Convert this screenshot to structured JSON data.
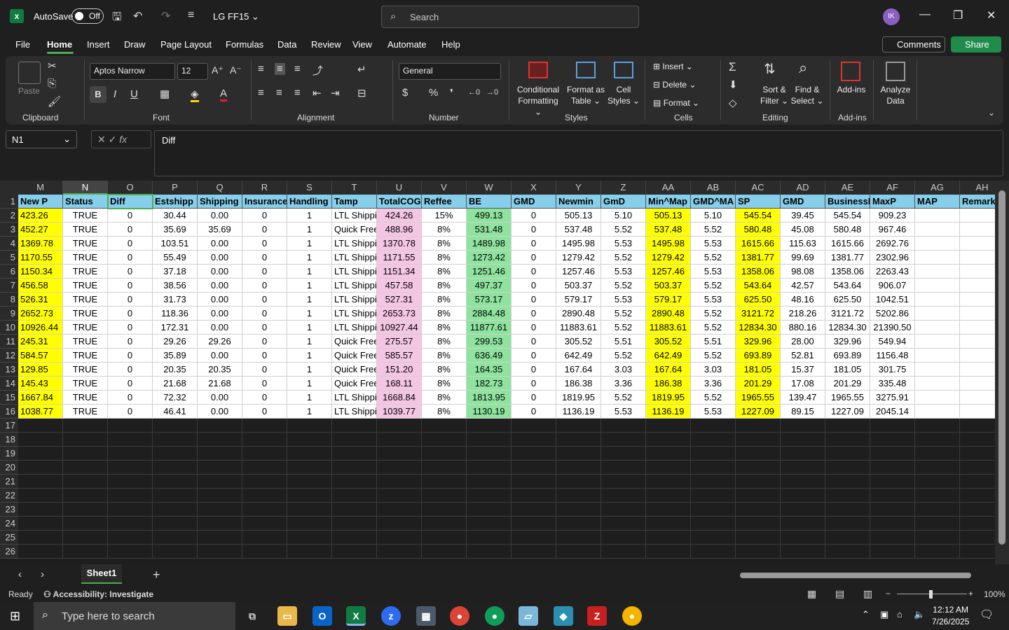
{
  "app": {
    "autosave_label": "AutoSave",
    "autosave_state": "Off",
    "filename": "LG FF15",
    "search_placeholder": "Search",
    "avatar": "IK"
  },
  "menu": [
    "File",
    "Home",
    "Insert",
    "Draw",
    "Page Layout",
    "Formulas",
    "Data",
    "Review",
    "View",
    "Automate",
    "Help"
  ],
  "buttons": {
    "comments": "Comments",
    "share": "Share"
  },
  "ribbon": {
    "clipboard": {
      "paste": "Paste",
      "label": "Clipboard"
    },
    "font": {
      "name": "Aptos Narrow",
      "size": "12",
      "label": "Font"
    },
    "alignment": {
      "label": "Alignment"
    },
    "number": {
      "format": "General",
      "label": "Number"
    },
    "styles": {
      "cond1": "Conditional",
      "cond2": "Formatting",
      "fmt1": "Format as",
      "fmt2": "Table",
      "cell1": "Cell",
      "cell2": "Styles",
      "label": "Styles"
    },
    "cells": {
      "insert": "Insert",
      "delete": "Delete",
      "format": "Format",
      "label": "Cells"
    },
    "editing": {
      "sort1": "Sort &",
      "sort2": "Filter",
      "find1": "Find &",
      "find2": "Select",
      "label": "Editing"
    },
    "addins": {
      "addins": "Add-ins",
      "label": "Add-ins"
    },
    "analyze": {
      "a1": "Analyze",
      "a2": "Data"
    }
  },
  "formula": {
    "namebox": "N1",
    "content": "Diff"
  },
  "columns": [
    "M",
    "N",
    "O",
    "P",
    "Q",
    "R",
    "S",
    "T",
    "U",
    "V",
    "W",
    "X",
    "Y",
    "Z",
    "AA",
    "AB",
    "AC",
    "AD",
    "AE",
    "AF",
    "AG",
    "AH"
  ],
  "header_row": [
    "New P",
    "Status",
    "Diff",
    "Estshipp",
    "Shipping",
    "Insurance",
    "Handling",
    "Tamp",
    "TotalCOG",
    "Reffee",
    "BE",
    "GMD",
    "Newmin",
    "GmD",
    "Min^Map",
    "GMD^MA",
    "SP",
    "GMD",
    "BusinessI",
    "MaxP",
    "MAP",
    "Remark"
  ],
  "rows": [
    [
      "423.26",
      "TRUE",
      "0",
      "30.44",
      "0.00",
      "0",
      "1",
      "LTL Shippi",
      "424.26",
      "15%",
      "499.13",
      "0",
      "505.13",
      "5.10",
      "505.13",
      "5.10",
      "545.54",
      "39.45",
      "545.54",
      "909.23",
      "",
      ""
    ],
    [
      "452.27",
      "TRUE",
      "0",
      "35.69",
      "35.69",
      "0",
      "1",
      "Quick Free",
      "488.96",
      "8%",
      "531.48",
      "0",
      "537.48",
      "5.52",
      "537.48",
      "5.52",
      "580.48",
      "45.08",
      "580.48",
      "967.46",
      "",
      ""
    ],
    [
      "1369.78",
      "TRUE",
      "0",
      "103.51",
      "0.00",
      "0",
      "1",
      "LTL Shippi",
      "1370.78",
      "8%",
      "1489.98",
      "0",
      "1495.98",
      "5.53",
      "1495.98",
      "5.53",
      "1615.66",
      "115.63",
      "1615.66",
      "2692.76",
      "",
      ""
    ],
    [
      "1170.55",
      "TRUE",
      "0",
      "55.49",
      "0.00",
      "0",
      "1",
      "LTL Shippi",
      "1171.55",
      "8%",
      "1273.42",
      "0",
      "1279.42",
      "5.52",
      "1279.42",
      "5.52",
      "1381.77",
      "99.69",
      "1381.77",
      "2302.96",
      "",
      ""
    ],
    [
      "1150.34",
      "TRUE",
      "0",
      "37.18",
      "0.00",
      "0",
      "1",
      "LTL Shippi",
      "1151.34",
      "8%",
      "1251.46",
      "0",
      "1257.46",
      "5.53",
      "1257.46",
      "5.53",
      "1358.06",
      "98.08",
      "1358.06",
      "2263.43",
      "",
      ""
    ],
    [
      "456.58",
      "TRUE",
      "0",
      "38.56",
      "0.00",
      "0",
      "1",
      "LTL Shippi",
      "457.58",
      "8%",
      "497.37",
      "0",
      "503.37",
      "5.52",
      "503.37",
      "5.52",
      "543.64",
      "42.57",
      "543.64",
      "906.07",
      "",
      ""
    ],
    [
      "526.31",
      "TRUE",
      "0",
      "31.73",
      "0.00",
      "0",
      "1",
      "LTL Shippi",
      "527.31",
      "8%",
      "573.17",
      "0",
      "579.17",
      "5.53",
      "579.17",
      "5.53",
      "625.50",
      "48.16",
      "625.50",
      "1042.51",
      "",
      ""
    ],
    [
      "2652.73",
      "TRUE",
      "0",
      "118.36",
      "0.00",
      "0",
      "1",
      "LTL Shippi",
      "2653.73",
      "8%",
      "2884.48",
      "0",
      "2890.48",
      "5.52",
      "2890.48",
      "5.52",
      "3121.72",
      "218.26",
      "3121.72",
      "5202.86",
      "",
      ""
    ],
    [
      "10926.44",
      "TRUE",
      "0",
      "172.31",
      "0.00",
      "0",
      "1",
      "LTL Shippi",
      "10927.44",
      "8%",
      "11877.61",
      "0",
      "11883.61",
      "5.52",
      "11883.61",
      "5.52",
      "12834.30",
      "880.16",
      "12834.30",
      "21390.50",
      "",
      ""
    ],
    [
      "245.31",
      "TRUE",
      "0",
      "29.26",
      "29.26",
      "0",
      "1",
      "Quick Free",
      "275.57",
      "8%",
      "299.53",
      "0",
      "305.52",
      "5.51",
      "305.52",
      "5.51",
      "329.96",
      "28.00",
      "329.96",
      "549.94",
      "",
      ""
    ],
    [
      "584.57",
      "TRUE",
      "0",
      "35.89",
      "0.00",
      "0",
      "1",
      "Quick Free",
      "585.57",
      "8%",
      "636.49",
      "0",
      "642.49",
      "5.52",
      "642.49",
      "5.52",
      "693.89",
      "52.81",
      "693.89",
      "1156.48",
      "",
      ""
    ],
    [
      "129.85",
      "TRUE",
      "0",
      "20.35",
      "20.35",
      "0",
      "1",
      "Quick Free",
      "151.20",
      "8%",
      "164.35",
      "0",
      "167.64",
      "3.03",
      "167.64",
      "3.03",
      "181.05",
      "15.37",
      "181.05",
      "301.75",
      "",
      ""
    ],
    [
      "145.43",
      "TRUE",
      "0",
      "21.68",
      "21.68",
      "0",
      "1",
      "Quick Free",
      "168.11",
      "8%",
      "182.73",
      "0",
      "186.38",
      "3.36",
      "186.38",
      "3.36",
      "201.29",
      "17.08",
      "201.29",
      "335.48",
      "",
      ""
    ],
    [
      "1667.84",
      "TRUE",
      "0",
      "72.32",
      "0.00",
      "0",
      "1",
      "LTL Shippi",
      "1668.84",
      "8%",
      "1813.95",
      "0",
      "1819.95",
      "5.52",
      "1819.95",
      "5.52",
      "1965.55",
      "139.47",
      "1965.55",
      "3275.91",
      "",
      ""
    ],
    [
      "1038.77",
      "TRUE",
      "0",
      "46.41",
      "0.00",
      "0",
      "1",
      "LTL Shippi",
      "1039.77",
      "8%",
      "1130.19",
      "0",
      "1136.19",
      "5.53",
      "1136.19",
      "5.53",
      "1227.09",
      "89.15",
      "1227.09",
      "2045.14",
      "",
      ""
    ]
  ],
  "row_numbers": [
    "1",
    "2",
    "3",
    "4",
    "5",
    "6",
    "7",
    "8",
    "9",
    "10",
    "11",
    "12",
    "13",
    "14",
    "15",
    "16",
    "17",
    "18",
    "19",
    "20",
    "21",
    "22",
    "23",
    "24",
    "25",
    "26"
  ],
  "sheet": {
    "name": "Sheet1"
  },
  "status": {
    "ready": "Ready",
    "accessibility": "Accessibility: Investigate",
    "zoom": "100%"
  },
  "taskbar": {
    "search": "Type here to search",
    "time": "12:12 AM",
    "date": "7/26/2025"
  },
  "colors": {
    "yellow": "#ffff00",
    "pink": "#f4c6e4",
    "green": "#8ee39e",
    "header_blue": "#87ceeb",
    "accent_green": "#4caf50"
  }
}
